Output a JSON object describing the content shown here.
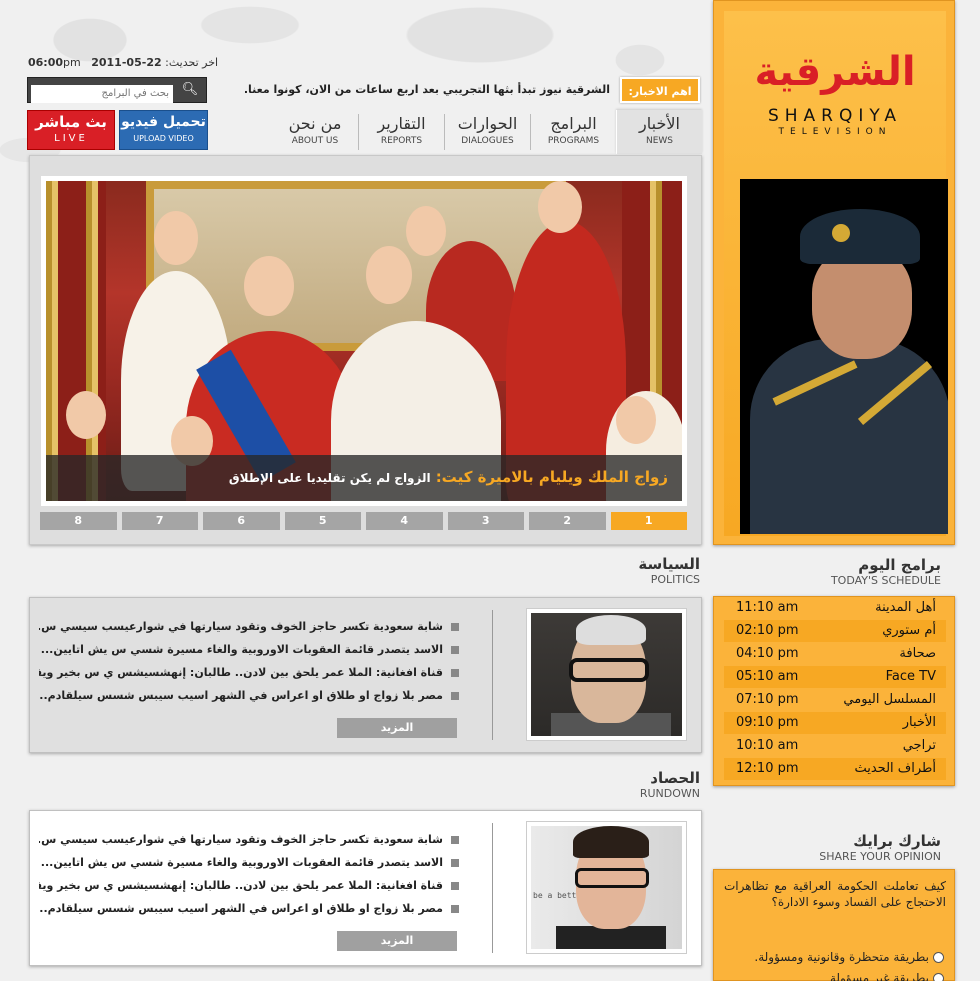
{
  "header": {
    "update_label": "اخر تحديث:",
    "update_date": "22-05-2011",
    "update_time": "06:00",
    "update_ampm": "pm",
    "search_placeholder": "بحث في البرامج",
    "live_ar": "بث مباشر",
    "live_en": "LIVE",
    "upload_ar": "تحميل فيديو",
    "upload_en": "UPLOAD VIDEO",
    "headline_tag": "اهم الاخبار:",
    "headline_text": "الشرقية نيوز تبدأ بثها التجريبي بعد اربع ساعات من الان، كونوا معنا."
  },
  "nav": [
    {
      "ar": "الأخبار",
      "en": "NEWS"
    },
    {
      "ar": "البرامج",
      "en": "PROGRAMS"
    },
    {
      "ar": "الحوارات",
      "en": "DIALOGUES"
    },
    {
      "ar": "التقارير",
      "en": "REPORTS"
    },
    {
      "ar": "من نحن",
      "en": "ABOUT US"
    }
  ],
  "slider": {
    "title": "زواج الملك ويليام بالاميرة كيت:",
    "subtitle": "الزواج لم يكن تقليديا على الإطلاق",
    "pages": [
      "8",
      "7",
      "6",
      "5",
      "4",
      "3",
      "2",
      "1"
    ],
    "active_page": "1"
  },
  "politics": {
    "title_ar": "السياسة",
    "title_en": "POLITICS",
    "items": [
      "شابة سعودية تكسر حاجز الخوف وتقود سيارتها في شوارعيسب سيسي س...",
      "الاسد يتصدر قائمة العقوبات الاوروبية والغاء مسيرة شسي س يش اتايين...",
      "قناة افغانية: الملا عمر يلحق بين لادن.. طالبان: إنهشسيشس ي س بخير ويقود...",
      "مصر بلا زواج او طلاق او اعراس في الشهر اسيب سيبس شسس سيلقادم..."
    ],
    "more": "المزيد"
  },
  "rundown": {
    "title_ar": "الحصاد",
    "title_en": "RUNDOWN",
    "items": [
      "شابة سعودية تكسر حاجز الخوف وتقود سيارتها في شوارعيسب سيسي س...",
      "الاسد يتصدر قائمة العقوبات الاوروبية والغاء مسيرة شسي س يش اتايين...",
      "قناة افغانية: الملا عمر يلحق بين لادن.. طالبان: إنهشسيشس ي س بخير ويقود...",
      "مصر بلا زواج او طلاق او اعراس في الشهر اسيب سيبس شسس سيلقادم..."
    ],
    "photo_text": "be a bette",
    "more": "المزيد"
  },
  "logo": {
    "ar": "الشرقية",
    "en": "SHARQIYA",
    "tv": "TELEVISION"
  },
  "schedule": {
    "title_ar": "برامج اليوم",
    "title_en": "TODAY'S SCHEDULE",
    "rows": [
      {
        "name": "أهل المدينة",
        "time": "11:10 am"
      },
      {
        "name": "أم ستوري",
        "time": "02:10 pm"
      },
      {
        "name": "صحافة",
        "time": "04:10 pm"
      },
      {
        "name": "Face TV",
        "time": "05:10 am"
      },
      {
        "name": "المسلسل اليومي",
        "time": "07:10 pm"
      },
      {
        "name": "الأخبار",
        "time": "09:10 pm"
      },
      {
        "name": "تراجي",
        "time": "10:10 am"
      },
      {
        "name": "أطراف الحديث",
        "time": "12:10 pm"
      }
    ]
  },
  "opinion": {
    "title_ar": "شارك برايك",
    "title_en": "SHARE YOUR OPINION",
    "question": "كيف تعاملت الحكومة العراقية مع تظاهرات الاحتجاج على الفساد وسوء الادارة؟",
    "options": [
      "بطريقة متحظرة وقانونية ومسؤولة.",
      "بطريقة غير مسؤولة"
    ]
  },
  "colors": {
    "accent": "#f7a823",
    "live": "#d91f26",
    "upload": "#2c6bb3"
  }
}
